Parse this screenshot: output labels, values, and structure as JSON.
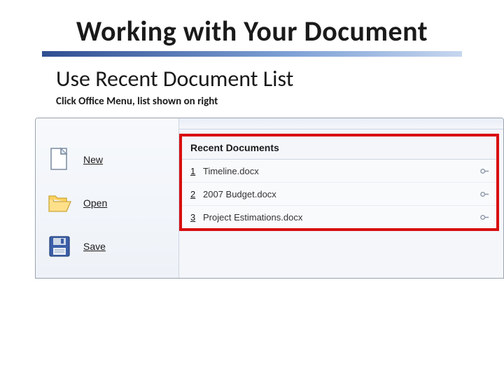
{
  "title": "Working with Your Document",
  "subtitle": "Use Recent Document List",
  "caption": "Click Office Menu, list shown on right",
  "menu": {
    "new_label": "New",
    "open_label": "Open",
    "save_label": "Save"
  },
  "recent": {
    "header": "Recent Documents",
    "items": [
      {
        "num": "1",
        "name": "Timeline.docx"
      },
      {
        "num": "2",
        "name": "2007 Budget.docx"
      },
      {
        "num": "3",
        "name": "Project Estimations.docx"
      }
    ]
  },
  "colors": {
    "highlight_border": "#d90e0e",
    "accent_gradient_start": "#2f4e91",
    "accent_gradient_end": "#c6d6ef"
  }
}
